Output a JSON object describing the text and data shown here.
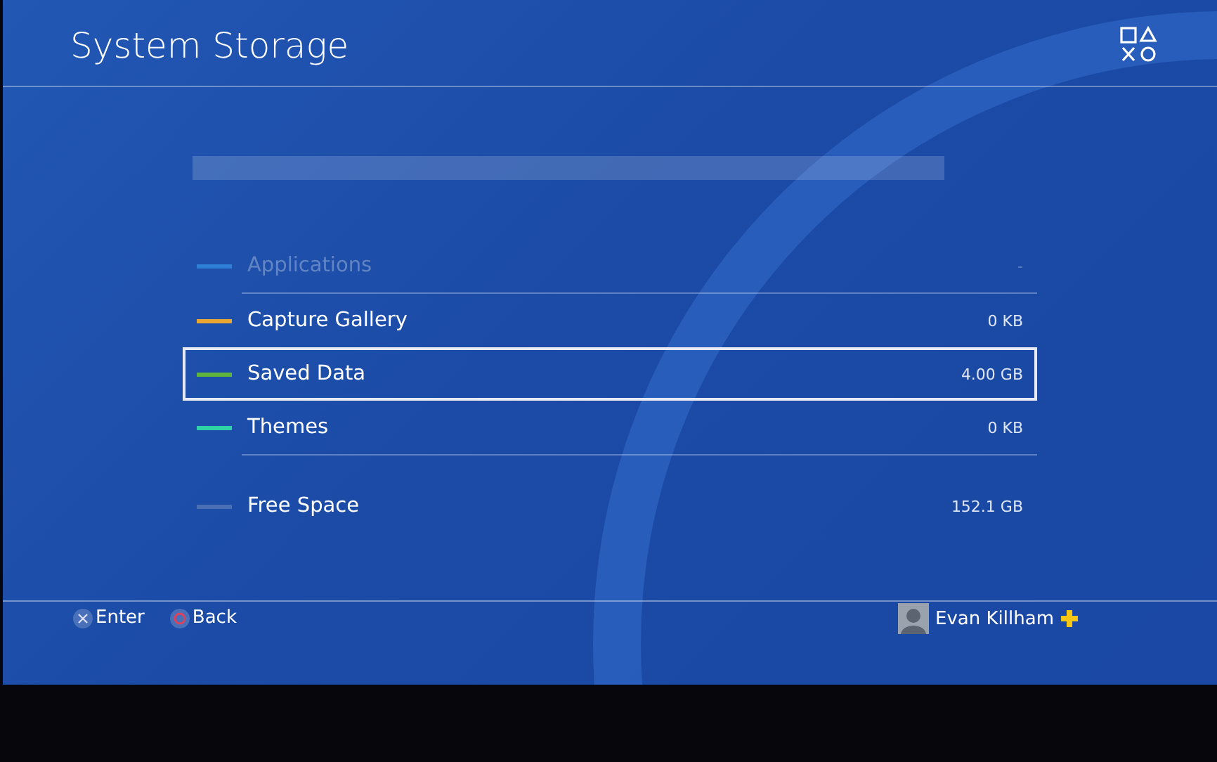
{
  "header": {
    "title": "System Storage"
  },
  "groups": [
    [
      {
        "label": "Applications",
        "value": "-",
        "color": "#2f7fd6",
        "disabled": true,
        "selected": false
      }
    ],
    [
      {
        "label": "Capture Gallery",
        "value": "0 KB",
        "color": "#e9a630",
        "disabled": false,
        "selected": false
      },
      {
        "label": "Saved Data",
        "value": "4.00 GB",
        "color": "#5fb53c",
        "disabled": false,
        "selected": true
      },
      {
        "label": "Themes",
        "value": "0 KB",
        "color": "#2fd1a6",
        "disabled": false,
        "selected": false
      }
    ],
    [
      {
        "label": "Free Space",
        "value": "152.1 GB",
        "color": "#4a6fb4",
        "disabled": false,
        "selected": false
      }
    ]
  ],
  "footer": {
    "hints": [
      {
        "kind": "cross",
        "label": "Enter"
      },
      {
        "kind": "circle",
        "label": "Back"
      }
    ],
    "user": {
      "name": "Evan Killham",
      "plus": true
    }
  }
}
